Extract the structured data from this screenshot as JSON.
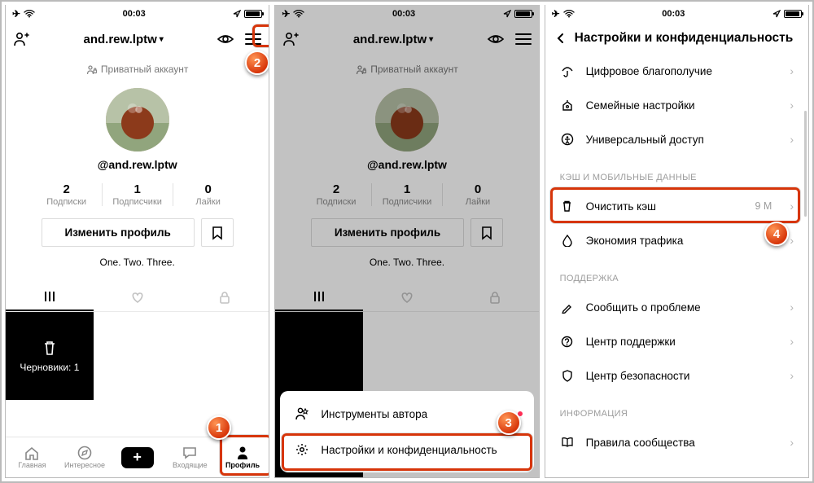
{
  "status": {
    "time": "00:03"
  },
  "header": {
    "title": "and.rew.lptw"
  },
  "private_label": "Приватный аккаунт",
  "username": "@and.rew.lptw",
  "stats": {
    "following": {
      "n": "2",
      "label": "Подписки"
    },
    "followers": {
      "n": "1",
      "label": "Подписчики"
    },
    "likes": {
      "n": "0",
      "label": "Лайки"
    }
  },
  "edit_label": "Изменить профиль",
  "bio": "One. Two. Three.",
  "drafts_label": "Черновики: 1",
  "nav": {
    "home": "Главная",
    "discover": "Интересное",
    "inbox": "Входящие",
    "profile": "Профиль"
  },
  "sheet": {
    "tools": "Инструменты автора",
    "settings": "Настройки и конфиденциальность"
  },
  "settings": {
    "title": "Настройки и конфиденциальность",
    "wellbeing": "Цифровое благополучие",
    "family": "Семейные настройки",
    "access": "Универсальный доступ",
    "sect_cache": "КЭШ И МОБИЛЬНЫЕ ДАННЫЕ",
    "clear_cache": "Очистить кэш",
    "clear_cache_val": "9 M",
    "saver": "Экономия трафика",
    "sect_support": "ПОДДЕРЖКА",
    "report": "Сообщить о проблеме",
    "help": "Центр поддержки",
    "safety": "Центр безопасности",
    "sect_info": "ИНФОРМАЦИЯ",
    "rules": "Правила сообщества"
  },
  "callouts": {
    "1": "1",
    "2": "2",
    "3": "3",
    "4": "4"
  }
}
